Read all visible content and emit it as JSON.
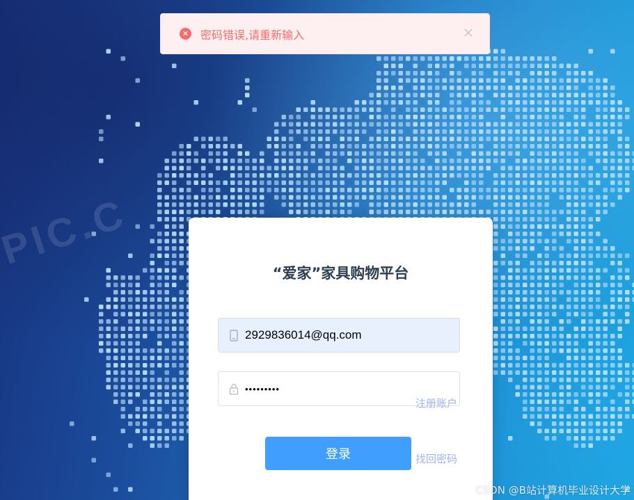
{
  "colors": {
    "background_dark": "#17327d",
    "background_light": "#1aa3df",
    "dot": "#bfe3ff",
    "error_text": "#f56c6c",
    "error_bg": "#fef0f0",
    "primary_button": "#409eff",
    "link": "#9fb4f0",
    "title": "#2c3e50"
  },
  "toast": {
    "type": "error",
    "icon": "error-circle-icon",
    "icon_glyph": "✕",
    "message": "密码错误,请重新输入",
    "close_icon": "close-icon",
    "close_glyph": "✕"
  },
  "background": {
    "pattern": "dotted-world-map",
    "watermark_text": "PIC.C"
  },
  "login": {
    "title": "“爱家”家具购物平台",
    "username": {
      "icon": "phone-icon",
      "value": "2929836014@qq.com",
      "placeholder": ""
    },
    "password": {
      "icon": "lock-icon",
      "value": "•••••••••",
      "placeholder": ""
    },
    "register_link": "注册账户",
    "login_button": "登录",
    "forgot_link": "找回密码"
  },
  "watermark": {
    "text": "CSDN @B站计算机毕业设计大学"
  }
}
